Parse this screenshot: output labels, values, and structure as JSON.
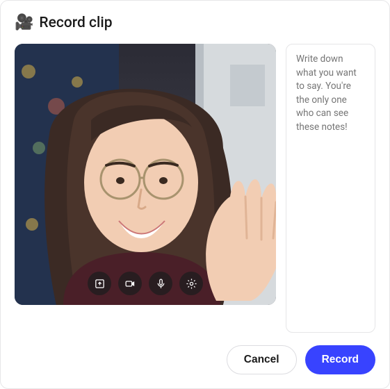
{
  "header": {
    "icon": "🎥",
    "title": "Record clip"
  },
  "notes": {
    "placeholder": "Write down what you want to say. You're the only one who can see these notes!"
  },
  "controls": {
    "upload": "upload-icon",
    "camera": "camera-icon",
    "mic": "microphone-icon",
    "settings": "gear-icon"
  },
  "footer": {
    "cancel": "Cancel",
    "record": "Record"
  },
  "colors": {
    "primary": "#3843ff"
  }
}
